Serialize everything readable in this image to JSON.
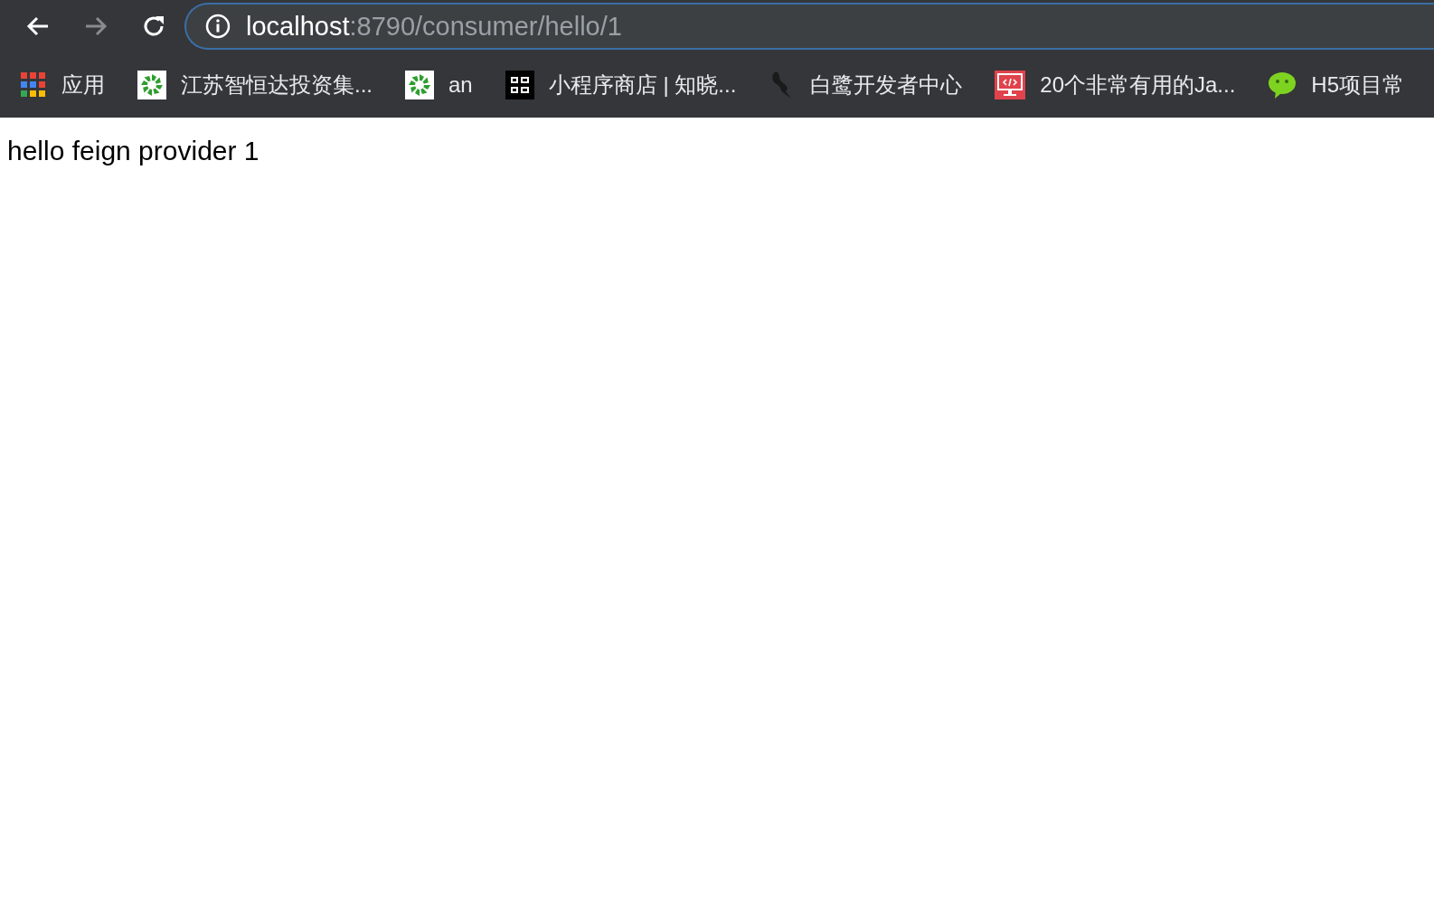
{
  "toolbar": {
    "back": {
      "disabled": false
    },
    "forward": {
      "disabled": true
    },
    "address": {
      "host": "localhost",
      "path": ":8790/consumer/hello/1"
    }
  },
  "bookmarks": [
    {
      "kind": "apps",
      "label": "应用"
    },
    {
      "kind": "star",
      "label": "江苏智恒达投资集..."
    },
    {
      "kind": "star",
      "label": "an"
    },
    {
      "kind": "qr",
      "label": "小程序商店 | 知晓..."
    },
    {
      "kind": "bird",
      "label": "白鹭开发者中心"
    },
    {
      "kind": "monitor",
      "label": "20个非常有用的Ja..."
    },
    {
      "kind": "chat",
      "label": "H5项目常"
    }
  ],
  "page": {
    "text": "hello feign provider 1"
  }
}
